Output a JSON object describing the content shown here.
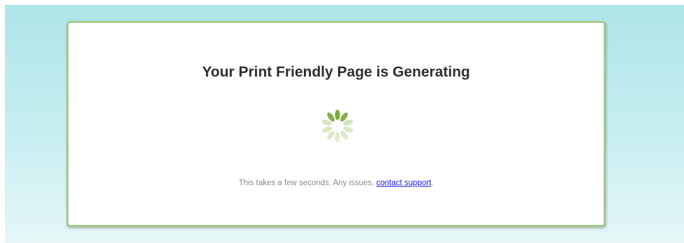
{
  "card": {
    "title": "Your Print Friendly Page is Generating",
    "spinner_icon": "loading-spinner-icon",
    "note_prefix": "This takes a few seconds. Any issues, ",
    "support_link_label": "contact support",
    "note_suffix": "."
  },
  "colors": {
    "background_top": "#aee5e8",
    "background_bottom": "#e6f6f7",
    "card_border": "#a6c889",
    "spinner_dark": "#7aa83a",
    "spinner_light": "#c9dfa8",
    "link": "#1a1ad8"
  }
}
